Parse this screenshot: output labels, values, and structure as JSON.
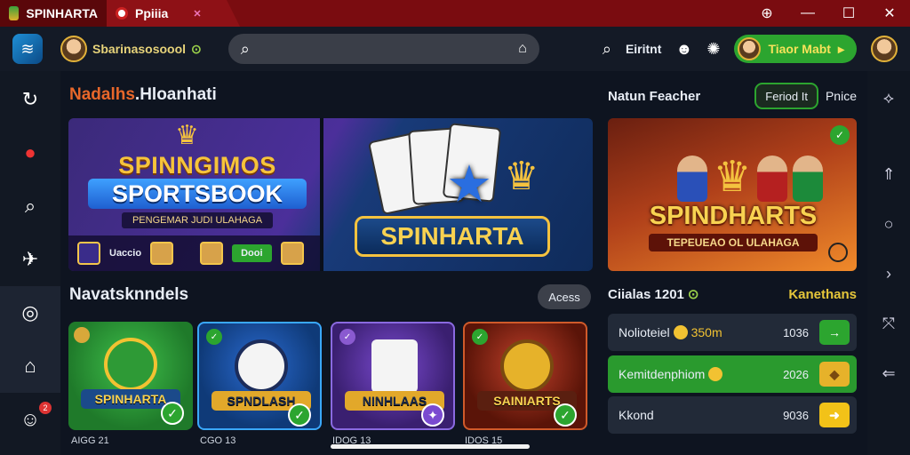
{
  "titlebar": {
    "tabs": [
      {
        "label": "SPINHARTA",
        "icon": "app-icon"
      },
      {
        "label": "Ppiiia",
        "icon": "favicon-icon",
        "close": "✕"
      }
    ],
    "controls": [
      "zoom-icon",
      "minimize-icon",
      "maximize-icon",
      "close-icon"
    ]
  },
  "appbar": {
    "username": "Sbarinasosoool",
    "search_placeholder": "",
    "right_label": "Eiritnt",
    "pill_label": "Tiaor Mabt"
  },
  "sidebar": {
    "items": [
      "history-icon",
      "ball-icon",
      "search-icon",
      "rocket-icon",
      "instagram-icon",
      "home-icon",
      "profile-icon"
    ],
    "badge": "2"
  },
  "main": {
    "section_title_accent": "Nadalhs",
    "section_title_rest": ".Hloanhati",
    "banner": {
      "title1": "SPINNGIMOS",
      "title2": "SPORTSBOOK",
      "subtitle": "PENGEMAR JUDI ULAHAGA",
      "bottom_left": "Uaccio",
      "bottom_right": "Dooi",
      "right_title": "SPINHARTA"
    },
    "section2_title": "Navatsknndels",
    "access_label": "Acess",
    "tiles": [
      {
        "name": "SPINHARTA",
        "caption": "AIGG 21",
        "color": "#1f7a2a"
      },
      {
        "name": "SPNDLASH",
        "caption": "CGO 13",
        "color": "#0f3a78"
      },
      {
        "name": "NINHLAAS",
        "caption": "IDOG 13",
        "color": "#4a2a8a"
      },
      {
        "name": "SAINIARTS",
        "caption": "IDOS 15",
        "color": "#7a2414"
      }
    ]
  },
  "right_panel": {
    "title": "Natun Feacher",
    "period_label": "Feriod It",
    "price_label": "Pnice",
    "banner_title": "SPINDHARTS",
    "banner_sub": "TEPEUEAO OL ULAHAGA",
    "list_title": "Ciialas 1201",
    "list_right": "Kanethans",
    "rows": [
      {
        "label": "Nolioteiel",
        "extra": "350m",
        "value": "1036",
        "action": "→",
        "bg": "#222a38",
        "act_bg": "#2ca52f"
      },
      {
        "label": "Kemitdenphiom",
        "extra": "",
        "value": "2026",
        "action": "◆",
        "bg": "#2a9a2e",
        "act_bg": "#e6b22a"
      },
      {
        "label": "Kkond",
        "extra": "",
        "value": "9036",
        "action": "➜",
        "bg": "#222a38",
        "act_bg": "#f2c218"
      }
    ]
  },
  "right_rail": [
    "chevron-icon",
    "up-icon",
    "circle-icon",
    "next-icon",
    "expand-icon",
    "back-icon"
  ]
}
